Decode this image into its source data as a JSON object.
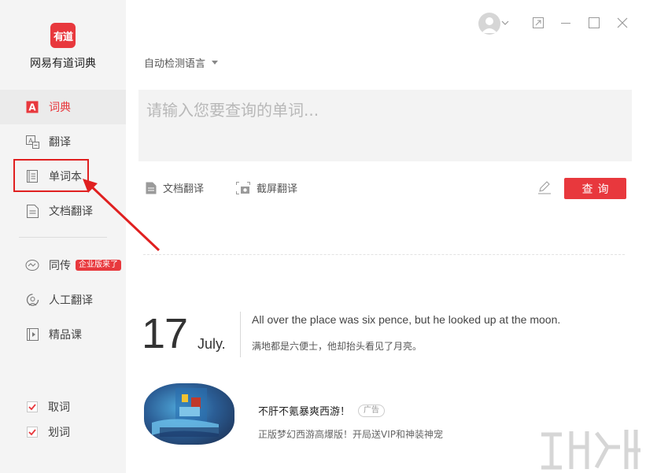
{
  "app": {
    "logo_text": "有道",
    "name": "网易有道词典"
  },
  "sidebar": {
    "nav_items": [
      {
        "label": "词典",
        "icon": "dictionary-icon",
        "active": true
      },
      {
        "label": "翻译",
        "icon": "translate-icon"
      },
      {
        "label": "单词本",
        "icon": "wordbook-icon"
      },
      {
        "label": "文档翻译",
        "icon": "document-icon"
      },
      {
        "label": "同传",
        "icon": "interpret-icon",
        "badge": "企业版来了"
      },
      {
        "label": "人工翻译",
        "icon": "human-translate-icon"
      },
      {
        "label": "精品课",
        "icon": "course-icon"
      }
    ],
    "options": [
      {
        "label": "取词",
        "checked": true
      },
      {
        "label": "划词",
        "checked": true
      }
    ]
  },
  "main": {
    "language_select": "自动检测语言",
    "search_placeholder": "请输入您要查询的单词...",
    "tools": {
      "doc_translate": "文档翻译",
      "screenshot_translate": "截屏翻译"
    },
    "query_button": "查询"
  },
  "daily": {
    "day": "17",
    "month": "July.",
    "sentence_en": "All over the place was six pence, but he looked up at the moon.",
    "sentence_zh": "满地都是六便士，他却抬头看见了月亮。"
  },
  "ad": {
    "title": "不肝不氪暴爽西游！",
    "tag": "广告",
    "subtitle": "正版梦幻西游高爆版！开局送VIP和神装神宠"
  },
  "colors": {
    "accent": "#e8383d",
    "sidebar_bg": "#f4f4f4",
    "highlight": "#e02020"
  }
}
